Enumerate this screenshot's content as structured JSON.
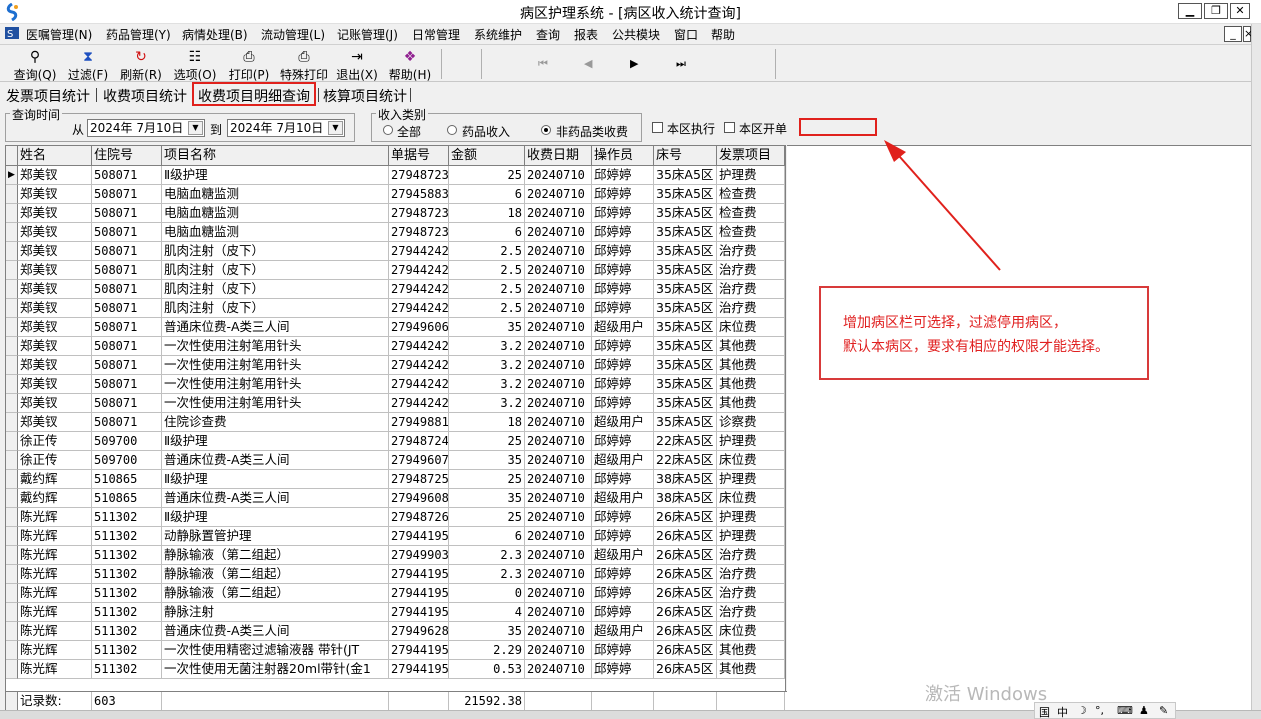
{
  "window": {
    "title": "病区护理系统 - [病区收入统计查询]",
    "minimize": "▁",
    "restore": "❐",
    "close": "✕"
  },
  "menu": {
    "items": [
      "医嘱管理(N)",
      "药品管理(Y)",
      "病情处理(B)",
      "流动管理(L)",
      "记账管理(J)",
      "日常管理",
      "系统维护",
      "查询",
      "报表",
      "公共模块",
      "窗口",
      "帮助"
    ],
    "mdi_min": "_",
    "mdi_close": "×"
  },
  "toolbar": {
    "query": "查询(Q)",
    "filter": "过滤(F)",
    "refresh": "刷新(R)",
    "options": "选项(O)",
    "print": "打印(P)",
    "special_print": "特殊打印",
    "exit": "退出(X)",
    "help": "帮助(H)",
    "nav_first": "⏮",
    "nav_prev": "◀",
    "nav_next": "▶",
    "nav_last": "⏭"
  },
  "tabs": [
    "发票项目统计",
    "收费项目统计",
    "收费项目明细查询",
    "核算项目统计"
  ],
  "filter": {
    "time_group": "查询时间",
    "from_label": "从",
    "from_date": "2024年 7月10日",
    "to_label": "到",
    "to_date": "2024年 7月10日",
    "income_group": "收入类别",
    "radio_all": "全部",
    "radio_drug": "药品收入",
    "radio_nondrug": "非药品类收费",
    "check_exec": "本区执行",
    "check_order": "本区开单"
  },
  "grid": {
    "columns": [
      "姓名",
      "住院号",
      "项目名称",
      "单据号",
      "金额",
      "收费日期",
      "操作员",
      "床号",
      "发票项目"
    ],
    "rows": [
      [
        "郑美钗",
        "508071",
        "Ⅱ级护理",
        "27948723",
        "25",
        "20240710",
        "邱婷婷",
        "35床A5区",
        "护理费"
      ],
      [
        "郑美钗",
        "508071",
        "电脑血糖监测",
        "27945883",
        "6",
        "20240710",
        "邱婷婷",
        "35床A5区",
        "检查费"
      ],
      [
        "郑美钗",
        "508071",
        "电脑血糖监测",
        "27948723",
        "18",
        "20240710",
        "邱婷婷",
        "35床A5区",
        "检查费"
      ],
      [
        "郑美钗",
        "508071",
        "电脑血糖监测",
        "27948723",
        "6",
        "20240710",
        "邱婷婷",
        "35床A5区",
        "检查费"
      ],
      [
        "郑美钗",
        "508071",
        "肌肉注射（皮下）",
        "27944242",
        "2.5",
        "20240710",
        "邱婷婷",
        "35床A5区",
        "治疗费"
      ],
      [
        "郑美钗",
        "508071",
        "肌肉注射（皮下）",
        "27944242",
        "2.5",
        "20240710",
        "邱婷婷",
        "35床A5区",
        "治疗费"
      ],
      [
        "郑美钗",
        "508071",
        "肌肉注射（皮下）",
        "27944242",
        "2.5",
        "20240710",
        "邱婷婷",
        "35床A5区",
        "治疗费"
      ],
      [
        "郑美钗",
        "508071",
        "肌肉注射（皮下）",
        "27944242",
        "2.5",
        "20240710",
        "邱婷婷",
        "35床A5区",
        "治疗费"
      ],
      [
        "郑美钗",
        "508071",
        "普通床位费-A类三人间",
        "27949606",
        "35",
        "20240710",
        "超级用户",
        "35床A5区",
        "床位费"
      ],
      [
        "郑美钗",
        "508071",
        "一次性使用注射笔用针头",
        "27944242",
        "3.2",
        "20240710",
        "邱婷婷",
        "35床A5区",
        "其他费"
      ],
      [
        "郑美钗",
        "508071",
        "一次性使用注射笔用针头",
        "27944242",
        "3.2",
        "20240710",
        "邱婷婷",
        "35床A5区",
        "其他费"
      ],
      [
        "郑美钗",
        "508071",
        "一次性使用注射笔用针头",
        "27944242",
        "3.2",
        "20240710",
        "邱婷婷",
        "35床A5区",
        "其他费"
      ],
      [
        "郑美钗",
        "508071",
        "一次性使用注射笔用针头",
        "27944242",
        "3.2",
        "20240710",
        "邱婷婷",
        "35床A5区",
        "其他费"
      ],
      [
        "郑美钗",
        "508071",
        "住院诊查费",
        "27949881",
        "18",
        "20240710",
        "超级用户",
        "35床A5区",
        "诊察费"
      ],
      [
        "徐正传",
        "509700",
        "Ⅱ级护理",
        "27948724",
        "25",
        "20240710",
        "邱婷婷",
        "22床A5区",
        "护理费"
      ],
      [
        "徐正传",
        "509700",
        "普通床位费-A类三人间",
        "27949607",
        "35",
        "20240710",
        "超级用户",
        "22床A5区",
        "床位费"
      ],
      [
        "戴约辉",
        "510865",
        "Ⅱ级护理",
        "27948725",
        "25",
        "20240710",
        "邱婷婷",
        "38床A5区",
        "护理费"
      ],
      [
        "戴约辉",
        "510865",
        "普通床位费-A类三人间",
        "27949608",
        "35",
        "20240710",
        "超级用户",
        "38床A5区",
        "床位费"
      ],
      [
        "陈光辉",
        "511302",
        "Ⅱ级护理",
        "27948726",
        "25",
        "20240710",
        "邱婷婷",
        "26床A5区",
        "护理费"
      ],
      [
        "陈光辉",
        "511302",
        "动静脉置管护理",
        "27944195",
        "6",
        "20240710",
        "邱婷婷",
        "26床A5区",
        "护理费"
      ],
      [
        "陈光辉",
        "511302",
        "静脉输液（第二组起）",
        "27949903",
        "2.3",
        "20240710",
        "超级用户",
        "26床A5区",
        "治疗费"
      ],
      [
        "陈光辉",
        "511302",
        "静脉输液（第二组起）",
        "27944195",
        "2.3",
        "20240710",
        "邱婷婷",
        "26床A5区",
        "治疗费"
      ],
      [
        "陈光辉",
        "511302",
        "静脉输液（第二组起）",
        "27944195",
        "0",
        "20240710",
        "邱婷婷",
        "26床A5区",
        "治疗费"
      ],
      [
        "陈光辉",
        "511302",
        "静脉注射",
        "27944195",
        "4",
        "20240710",
        "邱婷婷",
        "26床A5区",
        "治疗费"
      ],
      [
        "陈光辉",
        "511302",
        "普通床位费-A类三人间",
        "27949628",
        "35",
        "20240710",
        "超级用户",
        "26床A5区",
        "床位费"
      ],
      [
        "陈光辉",
        "511302",
        "一次性使用精密过滤输液器 带针(JT",
        "27944195",
        "2.29",
        "20240710",
        "邱婷婷",
        "26床A5区",
        "其他费"
      ],
      [
        "陈光辉",
        "511302",
        "一次性使用无菌注射器20ml带针(金1",
        "27944195",
        "0.53",
        "20240710",
        "邱婷婷",
        "26床A5区",
        "其他费"
      ]
    ],
    "footer_label": "记录数:",
    "footer_count": "603",
    "footer_total": "21592.38"
  },
  "annotation": {
    "line1": "增加病区栏可选择，过滤停用病区，",
    "line2": "默认本病区，要求有相应的权限才能选择。",
    "color": "#e02020"
  },
  "watermark": "激活 Windows",
  "ime": {
    "lang": "中",
    "items": [
      "国",
      "中",
      "☽",
      "°,",
      "⌨",
      "♟",
      "✎"
    ]
  }
}
